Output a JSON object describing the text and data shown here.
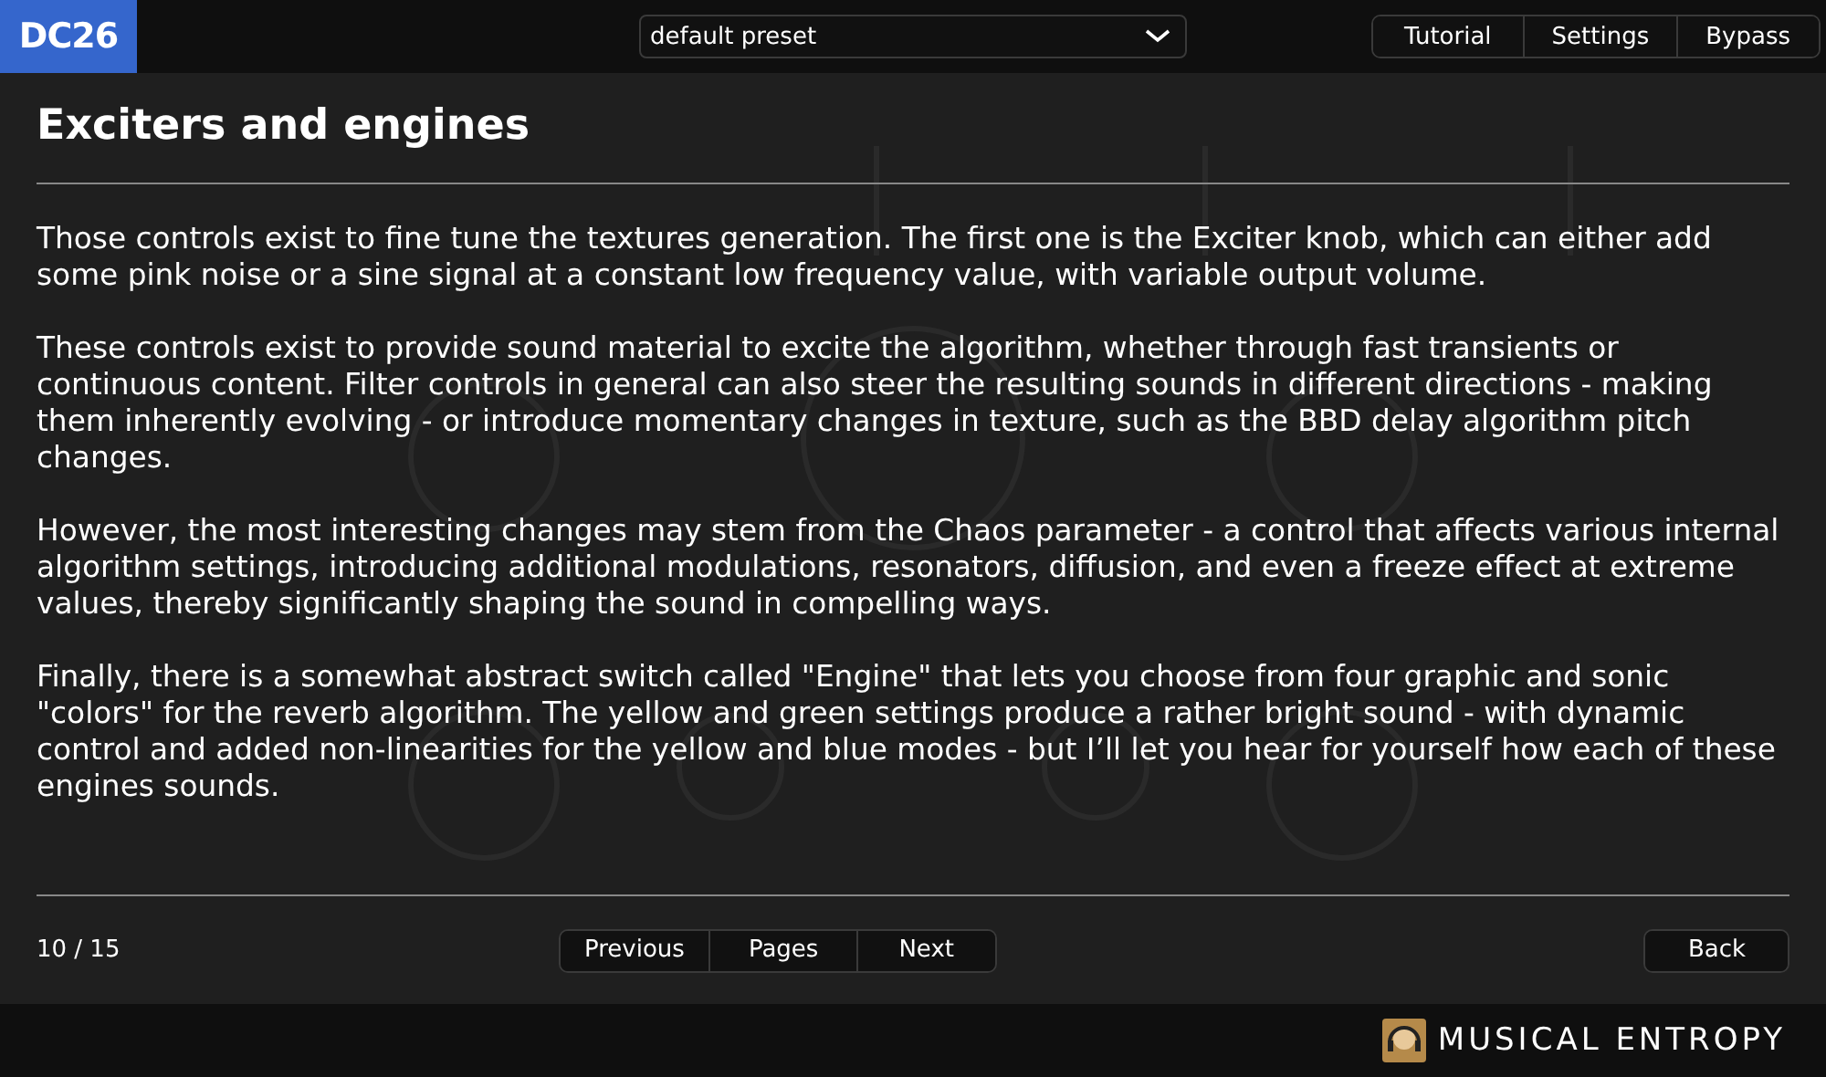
{
  "header": {
    "logo": "DC26",
    "preset": {
      "value": "default preset"
    },
    "buttons": [
      "Tutorial",
      "Settings",
      "Bypass"
    ]
  },
  "page": {
    "title": "Exciters and engines",
    "paragraphs": [
      "Those controls exist to fine tune the textures generation. The first one is the Exciter knob, which can either add some pink noise or a sine signal at a constant low frequency value, with variable output volume.",
      "These controls exist to provide sound material to excite the algorithm, whether through fast transients or continuous content. Filter controls in general can also steer the resulting sounds in different directions - making them inherently evolving - or introduce momentary changes in texture, such as the BBD delay algorithm pitch changes.",
      "However, the most interesting changes may stem from the Chaos parameter - a control that affects various internal algorithm settings, introducing additional modulations, resonators, diffusion, and even a freeze effect at extreme values, thereby significantly shaping the sound in compelling ways.",
      "Finally, there is a somewhat abstract switch called \"Engine\" that lets you choose from four graphic and sonic \"colors\" for the reverb algorithm. The yellow and green settings produce a rather bright sound - with dynamic control and added non-linearities for the yellow and blue modes - but I’ll let you hear for yourself how each of these engines sounds."
    ]
  },
  "nav": {
    "counter": "10 / 15",
    "buttons": [
      "Previous",
      "Pages",
      "Next"
    ],
    "back": "Back"
  },
  "footer": {
    "brand": "MUSICAL ENTROPY"
  }
}
